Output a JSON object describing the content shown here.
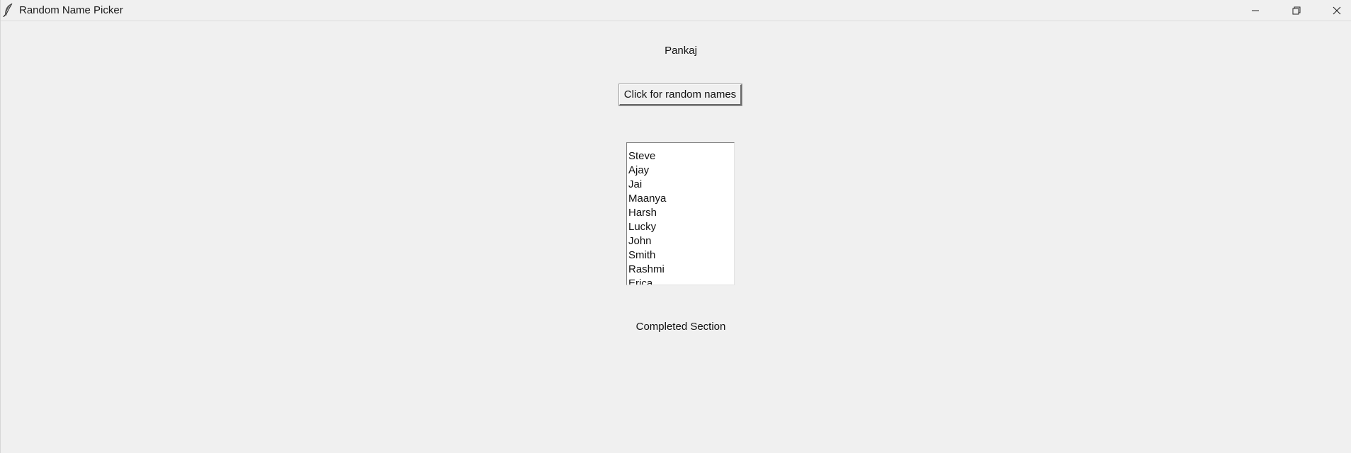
{
  "window": {
    "title": "Random Name Picker",
    "app_icon": "feather-icon",
    "controls": {
      "minimize_icon": "minimize-icon",
      "restore_icon": "restore-icon",
      "close_icon": "close-icon"
    }
  },
  "main": {
    "picked_name": "Pankaj",
    "random_button_label": "Click for random names",
    "names": [
      "Steve",
      "Ajay",
      "Jai",
      "Maanya",
      "Harsh",
      "Lucky",
      "John",
      "Smith",
      "Rashmi",
      "Erica"
    ],
    "status_text": "Completed Section"
  },
  "colors": {
    "background": "#f0f0f0",
    "listbox_background": "#ffffff",
    "text": "#111111"
  }
}
